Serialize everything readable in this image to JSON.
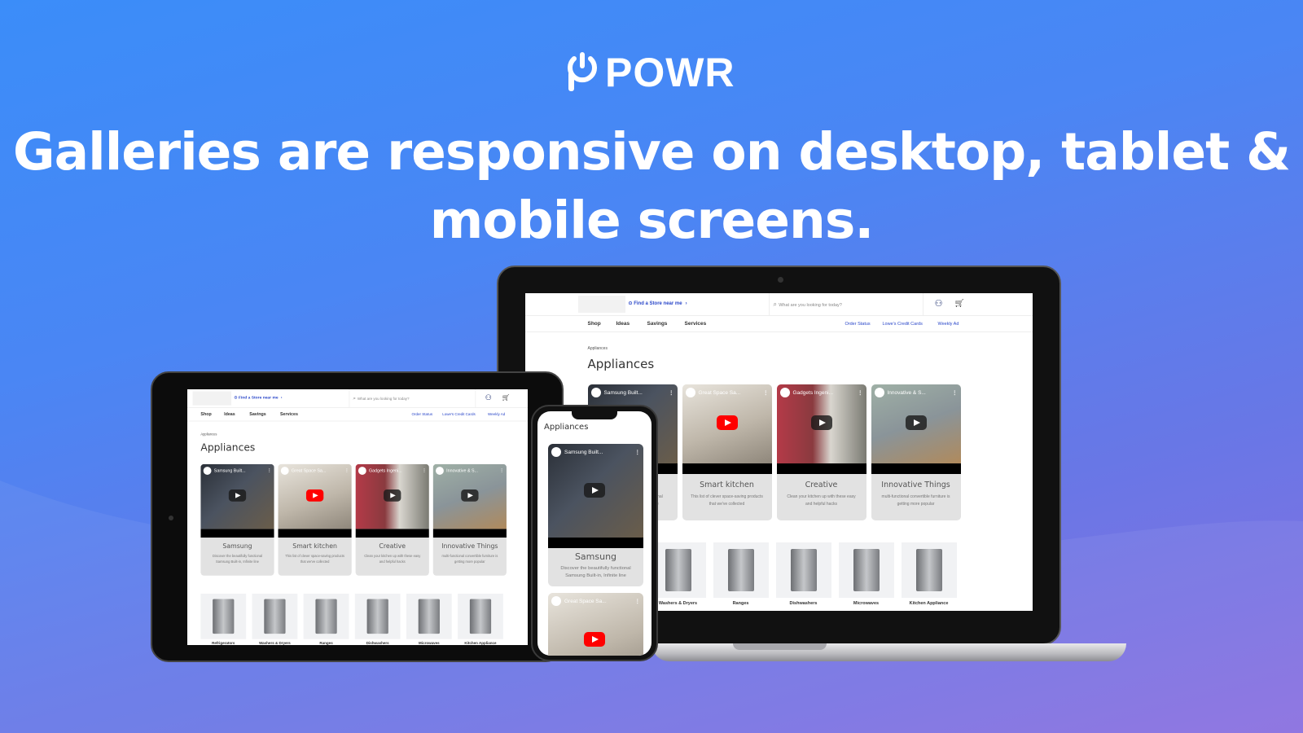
{
  "brand": {
    "name": "POWR",
    "icon": "powr-power-icon"
  },
  "headline": {
    "line1": "Galleries are responsive on desktop, tablet &",
    "line2": "mobile screens."
  },
  "site": {
    "store_link": "Find a Store near me",
    "store_chevron": "›",
    "search_placeholder": "What are you looking for today?",
    "nav": [
      "Shop",
      "Ideas",
      "Savings",
      "Services"
    ],
    "links": [
      "Order Status",
      "Lowe's Credit Cards",
      "Weekly Ad"
    ],
    "breadcrumb": "Appliances",
    "page_title": "Appliances",
    "cards": [
      {
        "video_title": "Samsung Built...",
        "title": "Samsung",
        "desc": "Discover the beautifully functional Samsung Built-in, Infinite line",
        "play": "dark",
        "bg": "linear-gradient(135deg,#2b3038,#4b5360 45%,#6a5d4a)"
      },
      {
        "video_title": "Great Space Sa...",
        "title": "Smart kitchen",
        "desc": "This list of clever space-saving products that we've collected",
        "play": "red",
        "bg": "linear-gradient(160deg,#e8e4dc,#bfb7aa 55%,#8f877b)"
      },
      {
        "video_title": "Gadgets Ingeni...",
        "title": "Creative",
        "desc": "Clean your kitchen up with these easy and helpful hacks",
        "play": "dark",
        "bg": "linear-gradient(90deg,#b43a48,#8a3a3f 40%,#d9d6cf 60%,#7a7a72)"
      },
      {
        "video_title": "Innovative & S...",
        "title": "Innovative Things",
        "desc": "multi-functional convertible furniture is getting more popular",
        "play": "dark",
        "bg": "linear-gradient(160deg,#9fb0a6,#8a9499 50%,#b08a5c)"
      }
    ],
    "categories": [
      "Refrigerators",
      "Washers & Dryers",
      "Ranges",
      "Dishwashers",
      "Microwaves",
      "Kitchen Appliance"
    ]
  },
  "colors": {
    "link": "#2a47c9",
    "youtube_red": "#ff0000"
  }
}
